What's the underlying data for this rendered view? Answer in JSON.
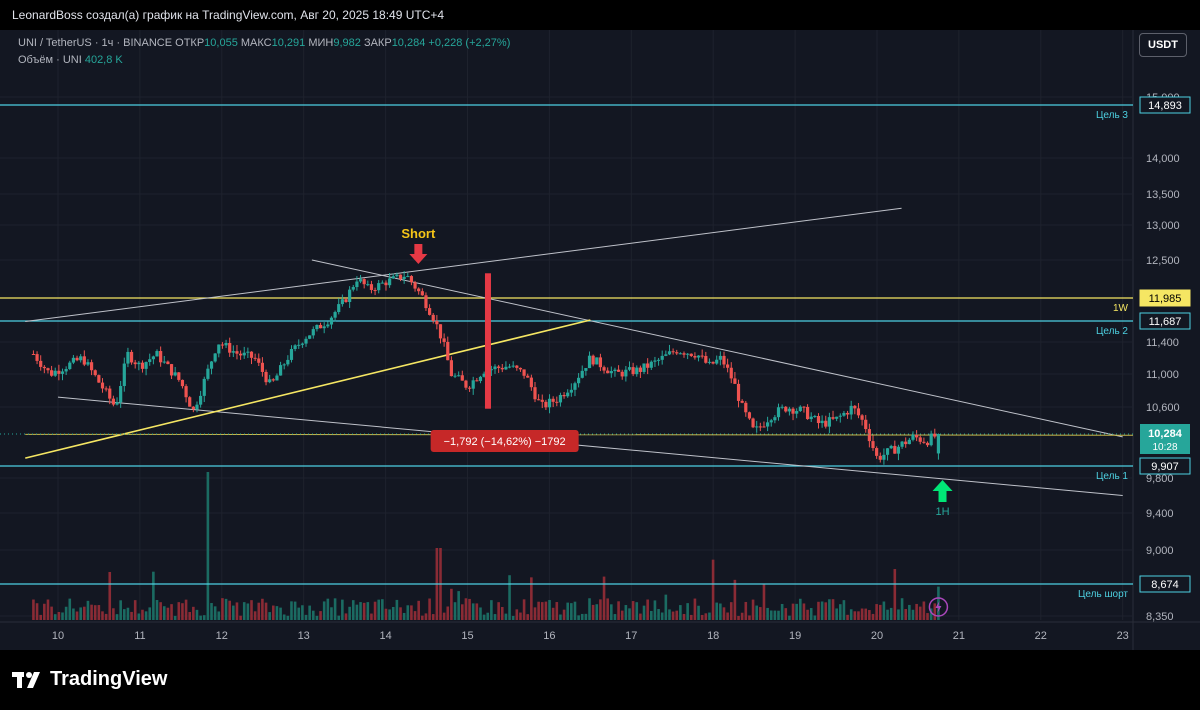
{
  "header": {
    "caption": "LeonardBoss создал(а) график на TradingView.com, Авг 20, 2025 18:49 UTC+4"
  },
  "legend": {
    "symbol": "UNI / TetherUS · 1ч · BINANCE",
    "open_label": "ОТКР",
    "open": "10,055",
    "high_label": "МАКС",
    "high": "10,291",
    "low_label": "МИН",
    "low": "9,982",
    "close_label": "ЗАКР",
    "close": "10,284",
    "change": "+0,228 (+2,27%)",
    "volume_label": "Объём · UNI",
    "volume": "402,8 K"
  },
  "currency_button": "USDT",
  "footer": {
    "brand": "TradingView"
  },
  "chart_data": {
    "type": "candlestick",
    "timeframe": "1h",
    "x_ticks": [
      "10",
      "11",
      "12",
      "13",
      "14",
      "15",
      "16",
      "17",
      "18",
      "19",
      "20",
      "21",
      "22",
      "23"
    ],
    "y_ticks": [
      "15,000",
      "14,000",
      "13,500",
      "13,000",
      "12,500",
      "11,400",
      "11,000",
      "10,600",
      "9,800",
      "9,400",
      "9,000",
      "8,350"
    ],
    "price_path": [
      [
        9.7,
        11.25
      ],
      [
        9.9,
        11.0
      ],
      [
        10.1,
        11.1
      ],
      [
        10.3,
        11.2
      ],
      [
        10.5,
        10.9
      ],
      [
        10.7,
        10.6
      ],
      [
        10.85,
        11.25
      ],
      [
        11.0,
        11.1
      ],
      [
        11.2,
        11.25
      ],
      [
        11.5,
        10.9
      ],
      [
        11.65,
        10.55
      ],
      [
        11.8,
        10.95
      ],
      [
        11.95,
        11.4
      ],
      [
        12.2,
        11.25
      ],
      [
        12.4,
        11.2
      ],
      [
        12.6,
        10.85
      ],
      [
        12.8,
        11.2
      ],
      [
        13.0,
        11.45
      ],
      [
        13.3,
        11.7
      ],
      [
        13.5,
        11.95
      ],
      [
        13.65,
        12.25
      ],
      [
        13.8,
        12.1
      ],
      [
        14.0,
        12.2
      ],
      [
        14.25,
        12.3
      ],
      [
        14.45,
        12.0
      ],
      [
        14.6,
        11.7
      ],
      [
        14.7,
        11.4
      ],
      [
        14.8,
        11.0
      ],
      [
        15.0,
        10.85
      ],
      [
        15.2,
        11.05
      ],
      [
        15.5,
        11.1
      ],
      [
        15.7,
        11.0
      ],
      [
        15.9,
        10.6
      ],
      [
        16.1,
        10.7
      ],
      [
        16.3,
        10.9
      ],
      [
        16.5,
        11.2
      ],
      [
        16.8,
        11.0
      ],
      [
        17.1,
        11.05
      ],
      [
        17.3,
        11.15
      ],
      [
        17.55,
        11.3
      ],
      [
        17.8,
        11.25
      ],
      [
        17.95,
        11.1
      ],
      [
        18.1,
        11.2
      ],
      [
        18.25,
        10.9
      ],
      [
        18.35,
        10.6
      ],
      [
        18.5,
        10.3
      ],
      [
        18.7,
        10.5
      ],
      [
        18.9,
        10.6
      ],
      [
        19.1,
        10.55
      ],
      [
        19.3,
        10.4
      ],
      [
        19.5,
        10.45
      ],
      [
        19.7,
        10.6
      ],
      [
        19.85,
        10.4
      ],
      [
        20.0,
        10.0
      ],
      [
        20.2,
        10.1
      ],
      [
        20.45,
        10.25
      ],
      [
        20.6,
        10.2
      ],
      [
        20.75,
        10.28
      ]
    ],
    "horizontal_levels": [
      {
        "label": "Цель 3",
        "tag": "14,893",
        "price": 14.893,
        "color": "#4dd0e1"
      },
      {
        "label": "1W",
        "tag": "11,985",
        "price": 11.985,
        "color": "#f5e663"
      },
      {
        "label": "Цель 2",
        "tag": "11,687",
        "price": 11.687,
        "color": "#4dd0e1"
      },
      {
        "label": "Цель 1",
        "tag": "9,907",
        "price": 9.907,
        "color": "#4dd0e1"
      },
      {
        "label": "Цель шорт",
        "tag": "8,674",
        "price": 8.674,
        "color": "#4dd0e1"
      }
    ],
    "current_price": {
      "value": "10,284",
      "countdown": "10:28",
      "price": 10.284
    },
    "annotations": {
      "short_label": "Short",
      "measure_label": "−1,792 (−14,62%) −1792",
      "tf_label": "1H",
      "flash_icon": "lightning-icon"
    }
  }
}
